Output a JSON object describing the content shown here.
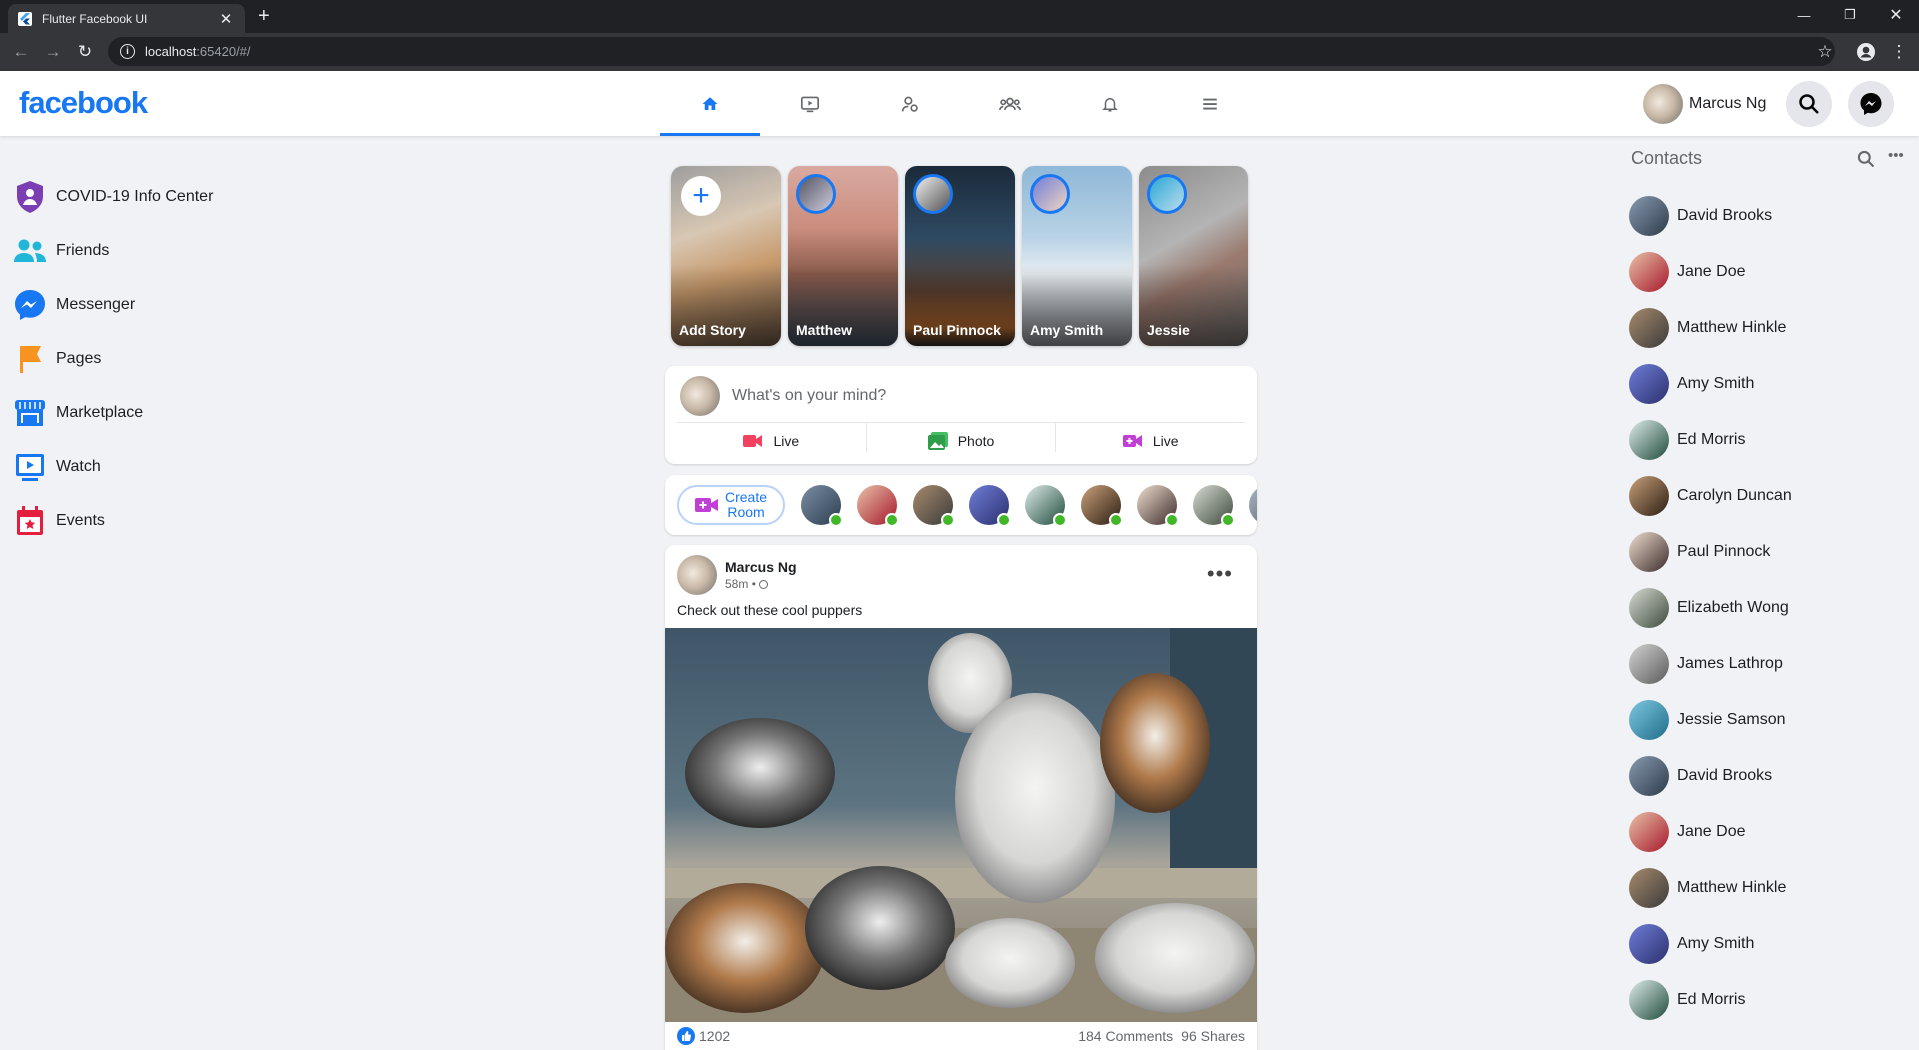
{
  "browser": {
    "tab_title": "Flutter Facebook UI",
    "url_host": "localhost",
    "url_rest": ":65420/#/"
  },
  "appbar": {
    "logo": "facebook",
    "user_name": "Marcus Ng",
    "tabs": [
      {
        "icon": "home-icon",
        "active": true
      },
      {
        "icon": "video-icon",
        "active": false
      },
      {
        "icon": "profile-icon",
        "active": false
      },
      {
        "icon": "groups-icon",
        "active": false
      },
      {
        "icon": "bell-icon",
        "active": false
      },
      {
        "icon": "menu-icon",
        "active": false
      }
    ],
    "accent_color": "#1877f2"
  },
  "sidebar": {
    "items": [
      {
        "label": "COVID-19 Info Center",
        "icon": "shield-icon"
      },
      {
        "label": "Friends",
        "icon": "friends-icon"
      },
      {
        "label": "Messenger",
        "icon": "messenger-icon"
      },
      {
        "label": "Pages",
        "icon": "flag-icon"
      },
      {
        "label": "Marketplace",
        "icon": "store-icon"
      },
      {
        "label": "Watch",
        "icon": "watch-icon"
      },
      {
        "label": "Events",
        "icon": "calendar-icon"
      }
    ]
  },
  "stories": [
    {
      "label": "Add Story"
    },
    {
      "label": "Matthew"
    },
    {
      "label": "Paul Pinnock"
    },
    {
      "label": "Amy Smith"
    },
    {
      "label": "Jessie"
    }
  ],
  "composer": {
    "placeholder": "What's on your mind?",
    "actions": [
      {
        "label": "Live",
        "icon": "live-video-icon"
      },
      {
        "label": "Photo",
        "icon": "photo-icon"
      },
      {
        "label": "Live",
        "icon": "video-room-icon"
      }
    ]
  },
  "rooms": {
    "create_label_1": "Create",
    "create_label_2": "Room"
  },
  "post": {
    "author": "Marcus Ng",
    "time": "58m",
    "dot": "•",
    "caption": "Check out these cool puppers",
    "likes": "1202",
    "comments": "184 Comments",
    "shares": "96 Shares"
  },
  "contacts": {
    "title": "Contacts",
    "items": [
      "David Brooks",
      "Jane Doe",
      "Matthew Hinkle",
      "Amy Smith",
      "Ed Morris",
      "Carolyn Duncan",
      "Paul Pinnock",
      "Elizabeth Wong",
      "James Lathrop",
      "Jessie Samson",
      "David Brooks",
      "Jane Doe",
      "Matthew Hinkle",
      "Amy Smith",
      "Ed Morris"
    ]
  }
}
